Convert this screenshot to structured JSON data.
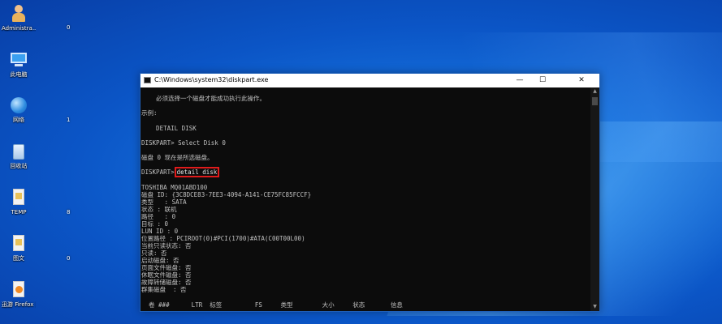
{
  "desktop": {
    "icons": [
      {
        "label": "Administra...",
        "icon": "user-folder-icon"
      },
      {
        "label": "此电脑",
        "icon": "this-pc-icon"
      },
      {
        "label": "网络",
        "icon": "network-icon"
      },
      {
        "label": "回收站",
        "icon": "recycle-bin-icon"
      },
      {
        "label": "TEMP",
        "icon": "file-icon"
      },
      {
        "label": "图文",
        "icon": "file-icon"
      },
      {
        "label": "迅游 Firefox 浏览",
        "icon": "firefox-file-icon"
      }
    ],
    "side_marks": [
      "0",
      "1",
      "8",
      "0"
    ]
  },
  "window": {
    "title": "C:\\Windows\\system32\\diskpart.exe",
    "minimize": "—",
    "maximize": "☐",
    "close": "✕"
  },
  "console": {
    "lines": [
      "    必须选择一个磁盘才能成功执行此操作。",
      "",
      "示例:",
      "",
      "    DETAIL DISK",
      "",
      "DISKPART> Select Disk 0",
      "",
      "磁盘 0 现在是所选磁盘。",
      "",
      "",
      "",
      "TOSHIBA MQ01ABD100",
      "磁盘 ID: {3C8DCE83-7EE3-4094-A141-CE75FC85FCCF}",
      "类型   : SATA",
      "状态 : 联机",
      "路径   : 0",
      "目标 : 0",
      "LUN ID : 0",
      "位置路径 : PCIROOT(0)#PCI(1700)#ATA(C00T00L00)",
      "当前只读状态: 否",
      "只读: 否",
      "启动磁盘: 否",
      "页面文件磁盘: 否",
      "休眠文件磁盘: 否",
      "故障转储磁盘: 否",
      "群集磁盘  : 否",
      "",
      "  卷 ###      LTR  标签         FS     类型        大小     状态       信息"
    ],
    "prompt": "DISKPART>",
    "highlighted_command": "detail disk",
    "highlight_color": "#e01b1b"
  }
}
